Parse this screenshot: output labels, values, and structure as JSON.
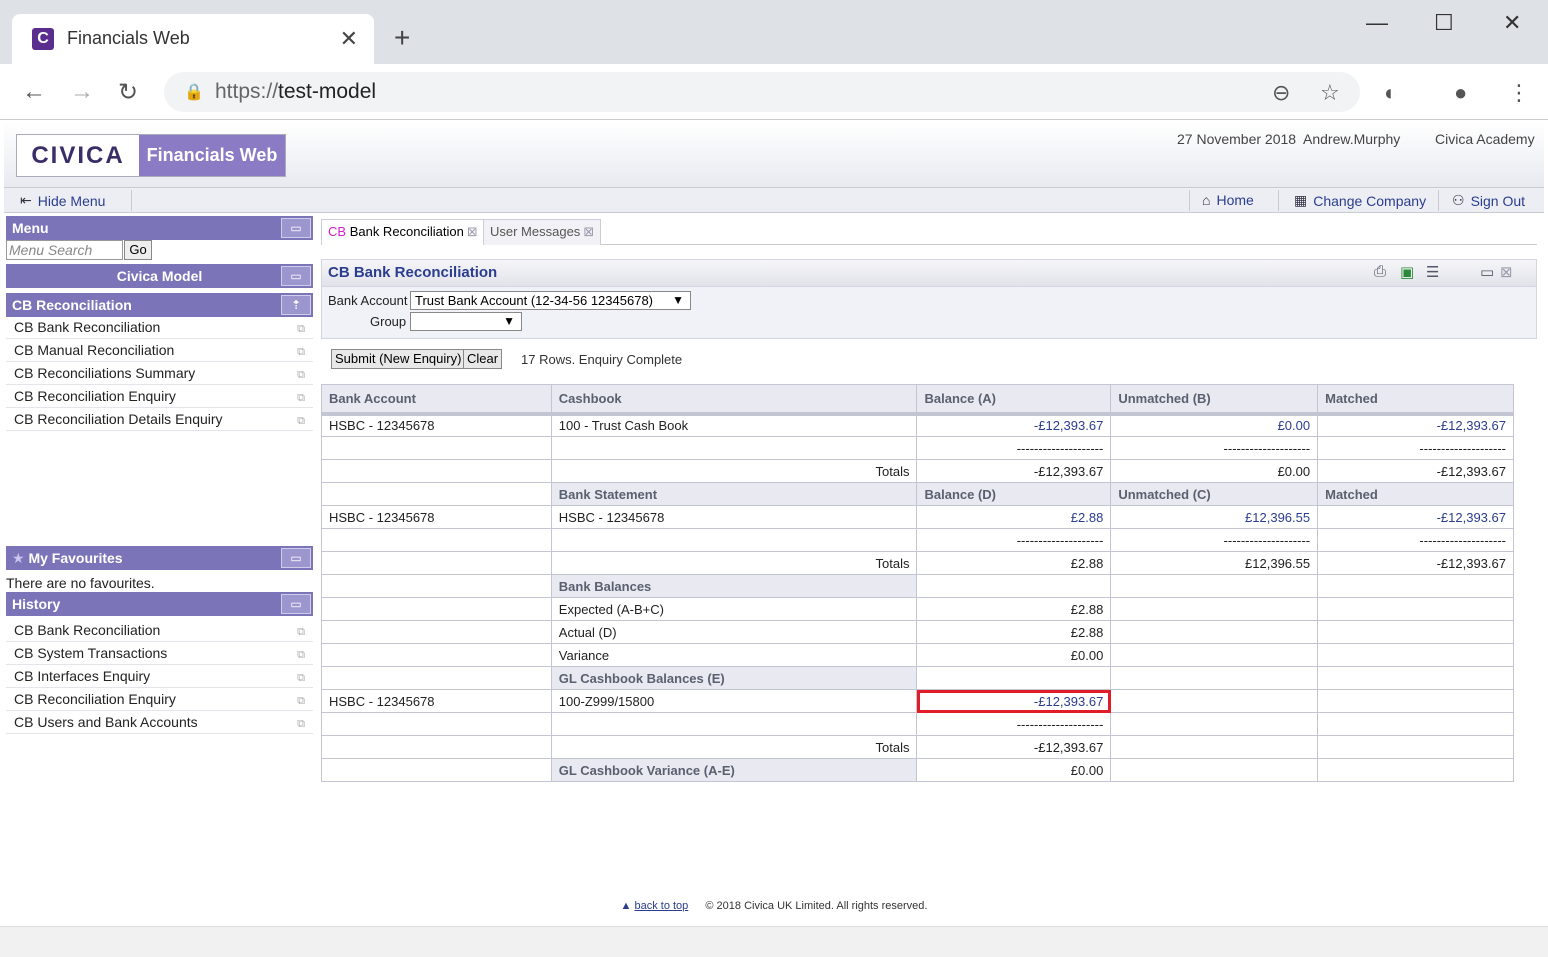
{
  "browser": {
    "tab_title": "Financials Web",
    "tab_icon_letter": "C",
    "url_scheme": "https://",
    "url_host": "test-model"
  },
  "header": {
    "logo_civica": "CIVICA",
    "logo_product": "Financials Web",
    "date": "27 November 2018",
    "user": "Andrew.Murphy",
    "company": "Civica Academy"
  },
  "navbar": {
    "hide_menu": "Hide Menu",
    "home": "Home",
    "change_company": "Change Company",
    "sign_out": "Sign Out"
  },
  "menu": {
    "title": "Menu",
    "search_placeholder": "Menu Search",
    "go": "Go",
    "model": "Civica Model",
    "section": "CB Reconciliation",
    "items": [
      "CB Bank Reconciliation",
      "CB Manual Reconciliation",
      "CB Reconciliations Summary",
      "CB Reconciliation Enquiry",
      "CB Reconciliation Details Enquiry"
    ]
  },
  "favourites": {
    "title": "My Favourites",
    "empty": "There are no favourites."
  },
  "history": {
    "title": "History",
    "items": [
      "CB Bank Reconciliation",
      "CB System Transactions",
      "CB Interfaces Enquiry",
      "CB Reconciliation Enquiry",
      "CB Users and Bank Accounts"
    ]
  },
  "content_tabs": {
    "active_prefix": "CB",
    "active_label": "Bank Reconciliation",
    "inactive_label": "User Messages"
  },
  "page": {
    "title": "CB Bank Reconciliation",
    "bank_account_label": "Bank Account",
    "bank_account_value": "Trust Bank Account (12-34-56 12345678)",
    "group_label": "Group",
    "group_value": "",
    "submit": "Submit (New Enquiry)",
    "clear": "Clear",
    "status": "17 Rows. Enquiry Complete"
  },
  "grid": {
    "headers": [
      "Bank Account",
      "Cashbook",
      "Balance (A)",
      "Unmatched (B)",
      "Matched"
    ],
    "dashes": "--------------------",
    "totals_label": "Totals",
    "r1": [
      "HSBC - 12345678",
      "100 - Trust Cash Book",
      "-£12,393.67",
      "£0.00",
      "-£12,393.67"
    ],
    "t1": [
      "-£12,393.67",
      "£0.00",
      "-£12,393.67"
    ],
    "sub1": [
      "Bank Statement",
      "Balance (D)",
      "Unmatched (C)",
      "Matched"
    ],
    "r2": [
      "HSBC - 12345678",
      "HSBC - 12345678",
      "£2.88",
      "£12,396.55",
      "-£12,393.67"
    ],
    "t2": [
      "£2.88",
      "£12,396.55",
      "-£12,393.67"
    ],
    "bank_balances": "Bank Balances",
    "expected_label": "Expected (A-B+C)",
    "expected_value": "£2.88",
    "actual_label": "Actual (D)",
    "actual_value": "£2.88",
    "variance_label": "Variance",
    "variance_value": "£0.00",
    "gl_balances": "GL Cashbook Balances (E)",
    "r3": [
      "HSBC - 12345678",
      "100-Z999/15800",
      "-£12,393.67"
    ],
    "t3": "-£12,393.67",
    "gl_variance_label": "GL Cashbook Variance (A-E)",
    "gl_variance_value": "£0.00"
  },
  "footer": {
    "back_to_top": "back to top",
    "copyright": "© 2018 Civica UK Limited. All rights reserved."
  }
}
